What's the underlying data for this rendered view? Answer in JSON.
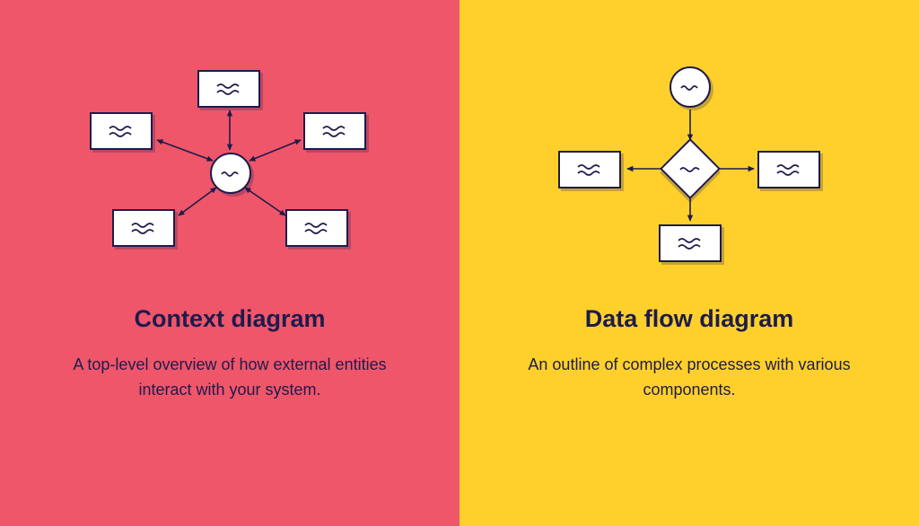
{
  "left": {
    "title": "Context diagram",
    "description": "A top-level overview of how external entities interact with your system.",
    "bg_color": "#ef566a"
  },
  "right": {
    "title": "Data flow diagram",
    "description": "An outline of complex processes with various components.",
    "bg_color": "#ffd02b"
  },
  "shape_stroke": "#1e1b4b",
  "shape_fill": "#ffffff"
}
